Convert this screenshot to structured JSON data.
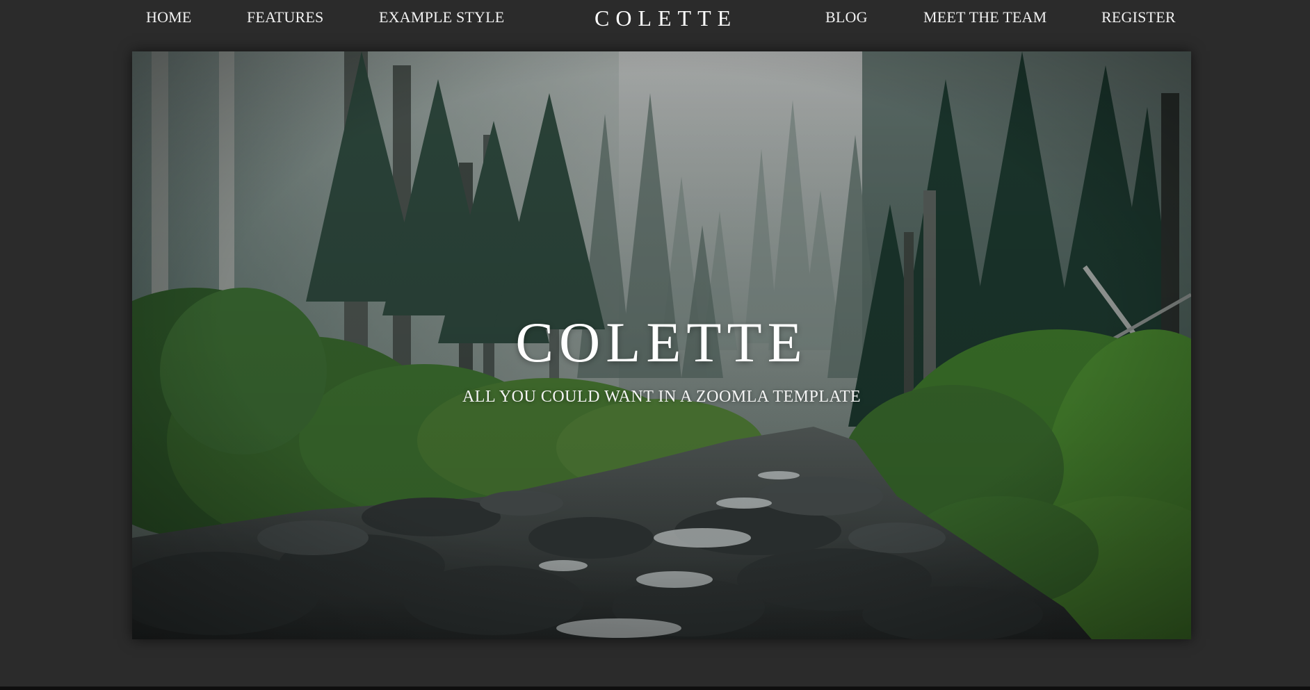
{
  "nav": {
    "left_items": [
      {
        "label": "HOME"
      },
      {
        "label": "FEATURES"
      },
      {
        "label": "EXAMPLE STYLE"
      }
    ],
    "brand": "COLETTE",
    "right_items": [
      {
        "label": "BLOG"
      },
      {
        "label": "MEET THE TEAM"
      },
      {
        "label": "REGISTER"
      }
    ]
  },
  "hero": {
    "title": "COLETTE",
    "subtitle": "ALL YOU COULD WANT IN A ZOOMLA TEMPLATE",
    "image": "misty forest with rocky stream"
  },
  "colors": {
    "background": "#2b2b2b",
    "nav_text": "#f2f2f2",
    "hero_text": "#ffffff"
  }
}
